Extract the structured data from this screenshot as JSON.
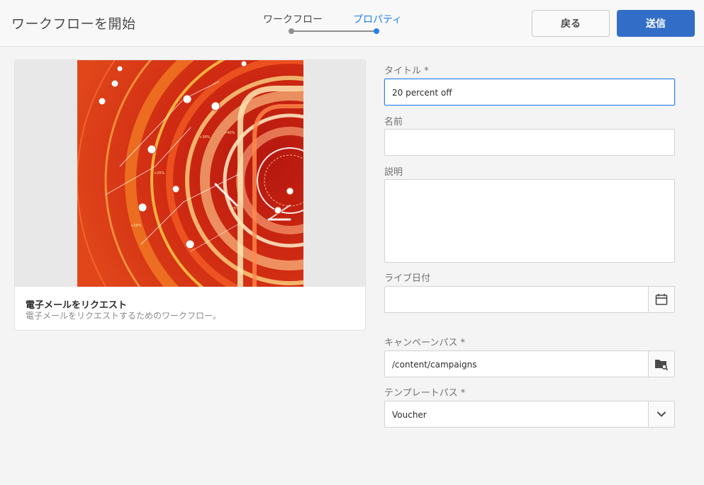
{
  "header": {
    "title": "ワークフローを開始",
    "steps": [
      {
        "label": "ワークフロー",
        "active": false
      },
      {
        "label": "プロパティ",
        "active": true
      }
    ],
    "back_label": "戻る",
    "submit_label": "送信",
    "accent_color": "#2680eb",
    "submit_color": "#326ec8"
  },
  "card": {
    "title": "電子メールをリクエスト",
    "description": "電子メールをリクエストするためのワークフロー。",
    "thumbnail_texts": [
      "+55%",
      "+39%",
      "+40%",
      "+25%",
      "+28%"
    ]
  },
  "form": {
    "title": {
      "label": "タイトル *",
      "value": "20 percent off"
    },
    "name": {
      "label": "名前",
      "value": ""
    },
    "description": {
      "label": "説明",
      "value": ""
    },
    "live_date": {
      "label": "ライブ日付",
      "value": "",
      "icon": "calendar-icon"
    },
    "campaign_path": {
      "label": "キャンペーンパス *",
      "value": "/content/campaigns",
      "icon": "folder-search-icon"
    },
    "template_path": {
      "label": "テンプレートパス *",
      "value": "Voucher",
      "icon": "chevron-down-icon"
    }
  }
}
